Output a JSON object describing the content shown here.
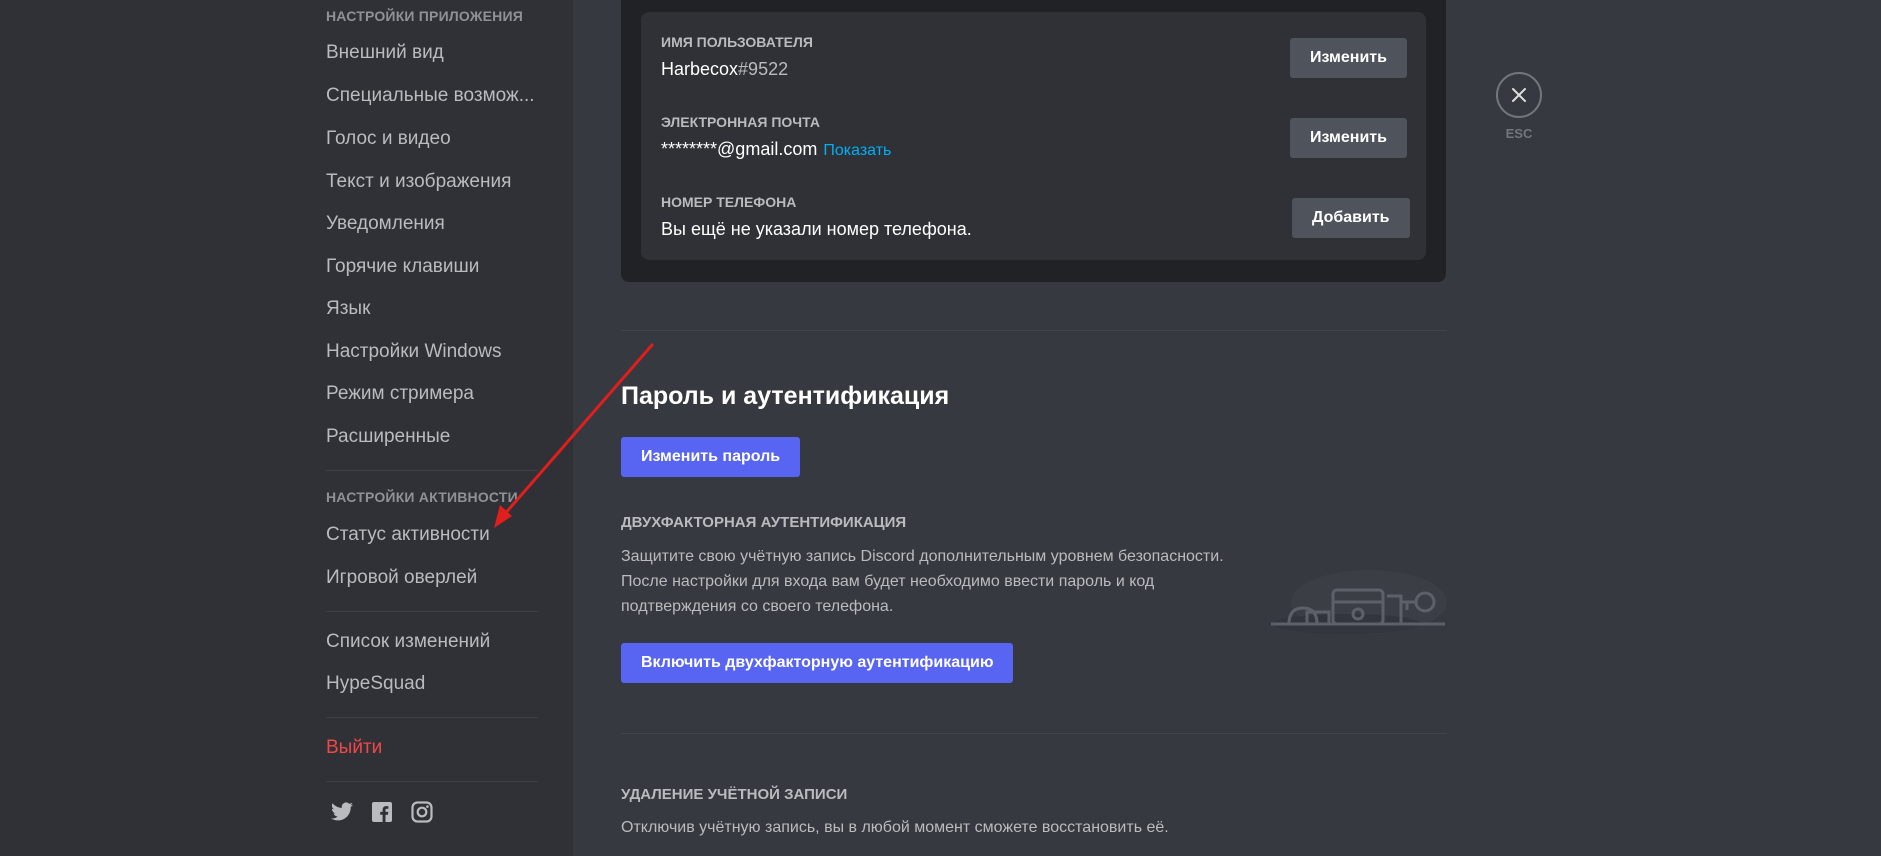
{
  "sidebar": {
    "app_settings_header": "НАСТРОЙКИ ПРИЛОЖЕНИЯ",
    "app_items": [
      "Внешний вид",
      "Специальные возмож...",
      "Голос и видео",
      "Текст и изображения",
      "Уведомления",
      "Горячие клавиши",
      "Язык",
      "Настройки Windows",
      "Режим стримера",
      "Расширенные"
    ],
    "activity_header": "НАСТРОЙКИ АКТИВНОСТИ",
    "activity_items": [
      "Статус активности",
      "Игровой оверлей"
    ],
    "misc_items": [
      "Список изменений",
      "HypeSquad"
    ],
    "logout": "Выйти",
    "social_icons": [
      "twitter-icon",
      "facebook-icon",
      "instagram-icon"
    ]
  },
  "account": {
    "username_label": "ИМЯ ПОЛЬЗОВАТЕЛЯ",
    "username": "Harbecox",
    "discriminator": "#9522",
    "email_label": "ЭЛЕКТРОННАЯ ПОЧТА",
    "email": "********@gmail.com",
    "email_reveal": "Показать",
    "phone_label": "НОМЕР ТЕЛЕФОНА",
    "phone_value": "Вы ещё не указали номер телефона.",
    "edit_label": "Изменить",
    "add_label": "Добавить"
  },
  "password_section": {
    "title": "Пароль и аутентификация",
    "change_password": "Изменить пароль",
    "twofa_title": "ДВУХФАКТОРНАЯ АУТЕНТИФИКАЦИЯ",
    "twofa_desc_1": "Защитите свою учётную запись Discord дополнительным уровнем безопасности.",
    "twofa_desc_2": "После настройки для входа вам будет необходимо ввести пароль и код",
    "twofa_desc_3": "подтверждения со своего телефона.",
    "enable_twofa": "Включить двухфакторную аутентификацию"
  },
  "deletion_section": {
    "title": "УДАЛЕНИЕ УЧЁТНОЙ ЗАПИСИ",
    "desc": "Отключив учётную запись, вы в любой момент сможете восстановить её."
  },
  "close": {
    "esc_label": "ESC"
  },
  "colors": {
    "accent": "#5865f2",
    "danger": "#f04747",
    "link": "#00aff4",
    "annotation_arrow": "#e01e1e"
  }
}
